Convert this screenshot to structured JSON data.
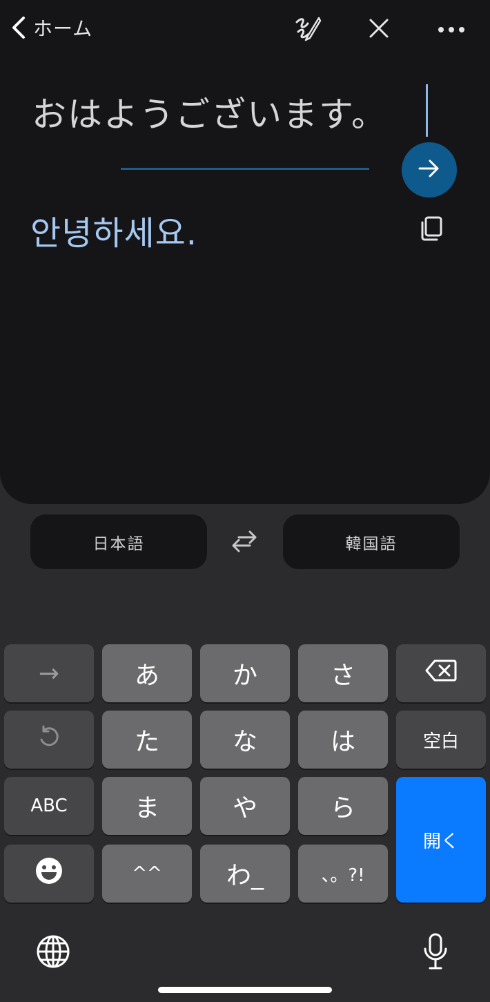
{
  "nav": {
    "back_label": "ホーム"
  },
  "translation": {
    "source_text": "おはようございます。",
    "target_text": "안녕하세요."
  },
  "languages": {
    "source": "日本語",
    "target": "韓国語"
  },
  "keyboard": {
    "row1": [
      "→",
      "あ",
      "か",
      "さ"
    ],
    "row2": [
      "た",
      "な",
      "は",
      "空白"
    ],
    "row3": [
      "ABC",
      "ま",
      "や",
      "ら"
    ],
    "row4": [
      "^^",
      "わ_",
      "、。?!"
    ],
    "enter_label": "開く"
  },
  "colors": {
    "accent_blue": "#0a7bfe",
    "send_button": "#0f5a8d",
    "target_text": "#a6c9f2",
    "card_background": "#151518",
    "keyboard_background": "#2b2b2d"
  },
  "icons": {
    "back": "chevron-left-icon",
    "handwriting": "handwriting-pen-icon",
    "close": "close-icon",
    "more": "more-horizontal-icon",
    "send": "arrow-right-icon",
    "copy": "copy-icon",
    "swap": "swap-arrows-icon",
    "backspace": "backspace-icon",
    "undo": "undo-icon",
    "emoji": "emoji-icon",
    "globe": "globe-icon",
    "microphone": "microphone-icon"
  }
}
